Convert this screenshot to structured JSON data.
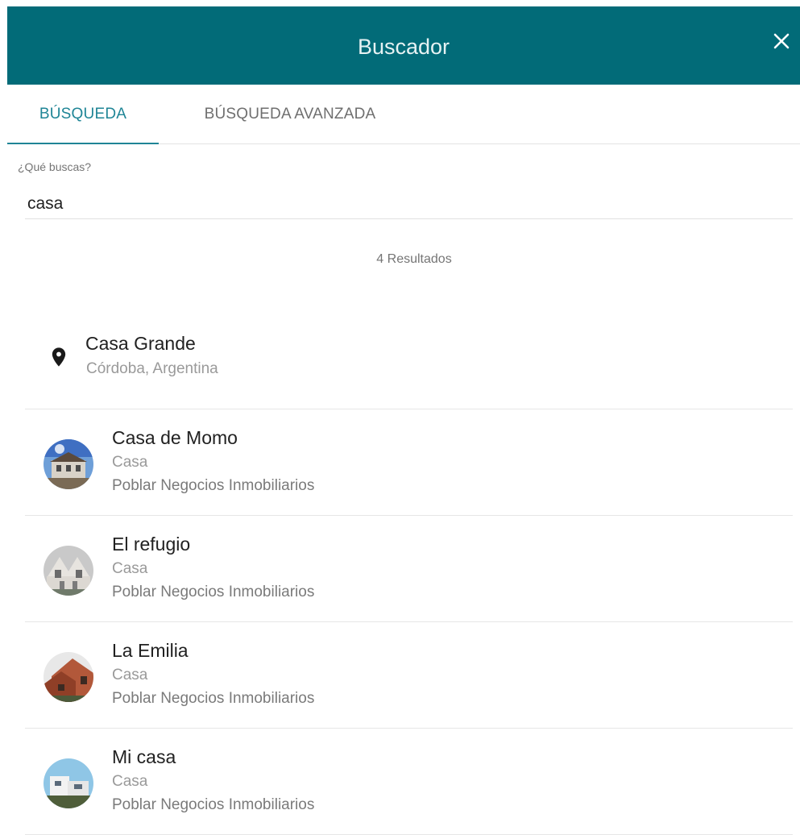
{
  "header": {
    "title": "Buscador",
    "close_icon": "close-icon",
    "background": "#026b78"
  },
  "tabs": [
    {
      "label": "BÚSQUEDA",
      "active": true
    },
    {
      "label": "BÚSQUEDA AVANZADA",
      "active": false
    }
  ],
  "search": {
    "label": "¿Qué buscas?",
    "value": "casa"
  },
  "results_count": "4 Resultados",
  "location_result": {
    "icon": "location-pin-icon",
    "title": "Casa Grande",
    "subtitle": "Córdoba, Argentina"
  },
  "results": [
    {
      "title": "Casa de Momo",
      "type": "Casa",
      "agency": "Poblar Negocios Inmobiliarios",
      "thumbnail": "house-photo-thumbnail"
    },
    {
      "title": "El refugio",
      "type": "Casa",
      "agency": "Poblar Negocios Inmobiliarios",
      "thumbnail": "house-photo-thumbnail"
    },
    {
      "title": "La Emilia",
      "type": "Casa",
      "agency": "Poblar Negocios Inmobiliarios",
      "thumbnail": "house-photo-thumbnail"
    },
    {
      "title": "Mi casa",
      "type": "Casa",
      "agency": "Poblar Negocios Inmobiliarios",
      "thumbnail": "house-photo-thumbnail"
    }
  ],
  "colors": {
    "accent": "#1f8596",
    "header": "#026b78",
    "divider": "#e6e6e6"
  }
}
